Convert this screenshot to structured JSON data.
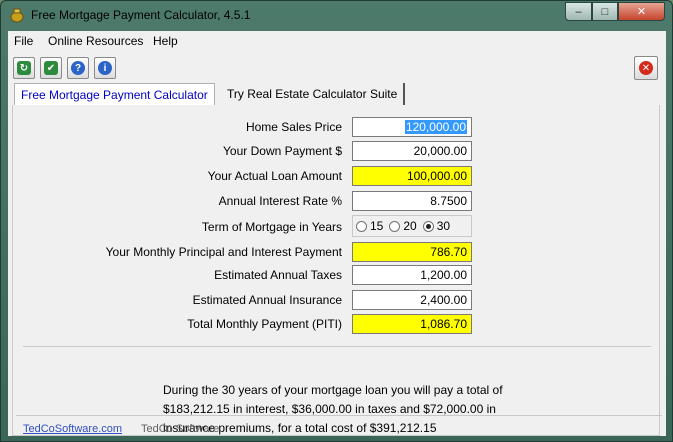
{
  "window": {
    "title": "Free Mortgage Payment Calculator, 4.5.1",
    "min_glyph": "‒",
    "max_glyph": "□",
    "close_glyph": "✕"
  },
  "menu": {
    "items": [
      "File",
      "Online Resources",
      "Help"
    ]
  },
  "toolbar": {
    "buttons": [
      {
        "icon": "refresh-icon",
        "glyph": "↻",
        "color": "#2e8b3d"
      },
      {
        "icon": "checkmark-down-icon",
        "glyph": "✔",
        "color": "#2e8b3d"
      },
      {
        "icon": "help-icon",
        "glyph": "?",
        "color": "#2a64c8"
      },
      {
        "icon": "info-icon",
        "glyph": "i",
        "color": "#2a64c8"
      }
    ],
    "exit_glyph": "✕",
    "exit_color": "#d42a1a"
  },
  "tabs": {
    "active": "Free Mortgage Payment Calculator",
    "inactive": "Try Real Estate Calculator Suite"
  },
  "form": {
    "home_price_label": "Home Sales Price",
    "home_price": "120,000.00",
    "down_payment_label": "Your Down Payment $",
    "down_payment": "20,000.00",
    "loan_amount_label": "Your Actual Loan Amount",
    "loan_amount": "100,000.00",
    "interest_label": "Annual Interest Rate %",
    "interest": "8.7500",
    "term_label": "Term of Mortgage in Years",
    "term_options": [
      "15",
      "20",
      "30"
    ],
    "term_selected": "30",
    "monthly_pi_label": "Your Monthly Principal and Interest Payment",
    "monthly_pi": "786.70",
    "taxes_label": "Estimated Annual Taxes",
    "taxes": "1,200.00",
    "insurance_label": "Estimated Annual Insurance",
    "insurance": "2,400.00",
    "piti_label": "Total Monthly Payment (PITI)",
    "piti": "1,086.70"
  },
  "summary": {
    "line1": "During the 30 years of your mortgage loan you will pay a total of",
    "line2": "$183,212.15 in interest, $36,000.00 in taxes and $72,000.00 in",
    "line3": "insurance premiums, for a total cost of $391,212.15"
  },
  "footer": {
    "link": "TedCoSoftware.com",
    "brand": "TedCo Software"
  },
  "colors": {
    "highlight": "#ffff00",
    "tab_active_text": "#0000c0"
  }
}
